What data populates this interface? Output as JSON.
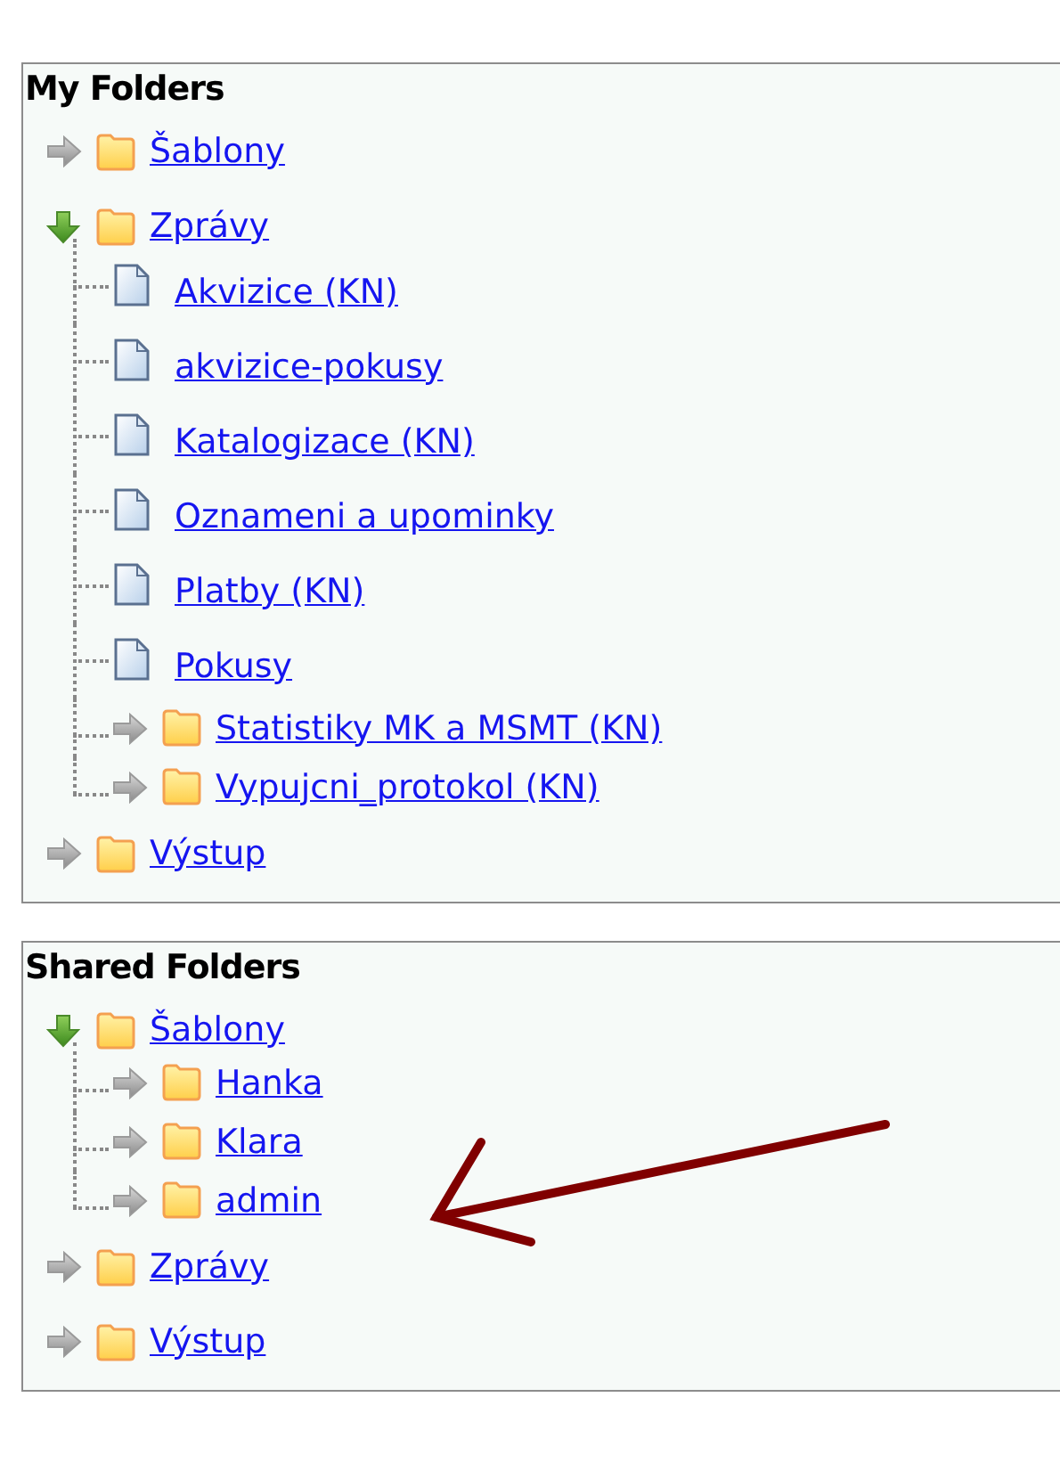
{
  "sections": [
    {
      "title": "My Folders",
      "items": [
        {
          "kind": "folder",
          "label": "Šablony",
          "expanded": false
        },
        {
          "kind": "folder",
          "label": "Zprávy",
          "expanded": true,
          "children": [
            {
              "kind": "document",
              "label": "Akvizice (KN)"
            },
            {
              "kind": "document",
              "label": "akvizice-pokusy"
            },
            {
              "kind": "document",
              "label": "Katalogizace (KN)"
            },
            {
              "kind": "document",
              "label": "Oznameni a upominky"
            },
            {
              "kind": "document",
              "label": "Platby (KN)"
            },
            {
              "kind": "document",
              "label": "Pokusy"
            },
            {
              "kind": "folder",
              "label": "Statistiky MK a MSMT (KN)",
              "expanded": false
            },
            {
              "kind": "folder",
              "label": "Vypujcni_protokol (KN)",
              "expanded": false
            }
          ]
        },
        {
          "kind": "folder",
          "label": "Výstup",
          "expanded": false
        }
      ]
    },
    {
      "title": "Shared Folders",
      "items": [
        {
          "kind": "folder",
          "label": "Šablony",
          "expanded": true,
          "children": [
            {
              "kind": "folder",
              "label": "Hanka",
              "expanded": false
            },
            {
              "kind": "folder",
              "label": "Klara",
              "expanded": false
            },
            {
              "kind": "folder",
              "label": "admin",
              "expanded": false
            }
          ]
        },
        {
          "kind": "folder",
          "label": "Zprávy",
          "expanded": false
        },
        {
          "kind": "folder",
          "label": "Výstup",
          "expanded": false
        }
      ]
    }
  ]
}
